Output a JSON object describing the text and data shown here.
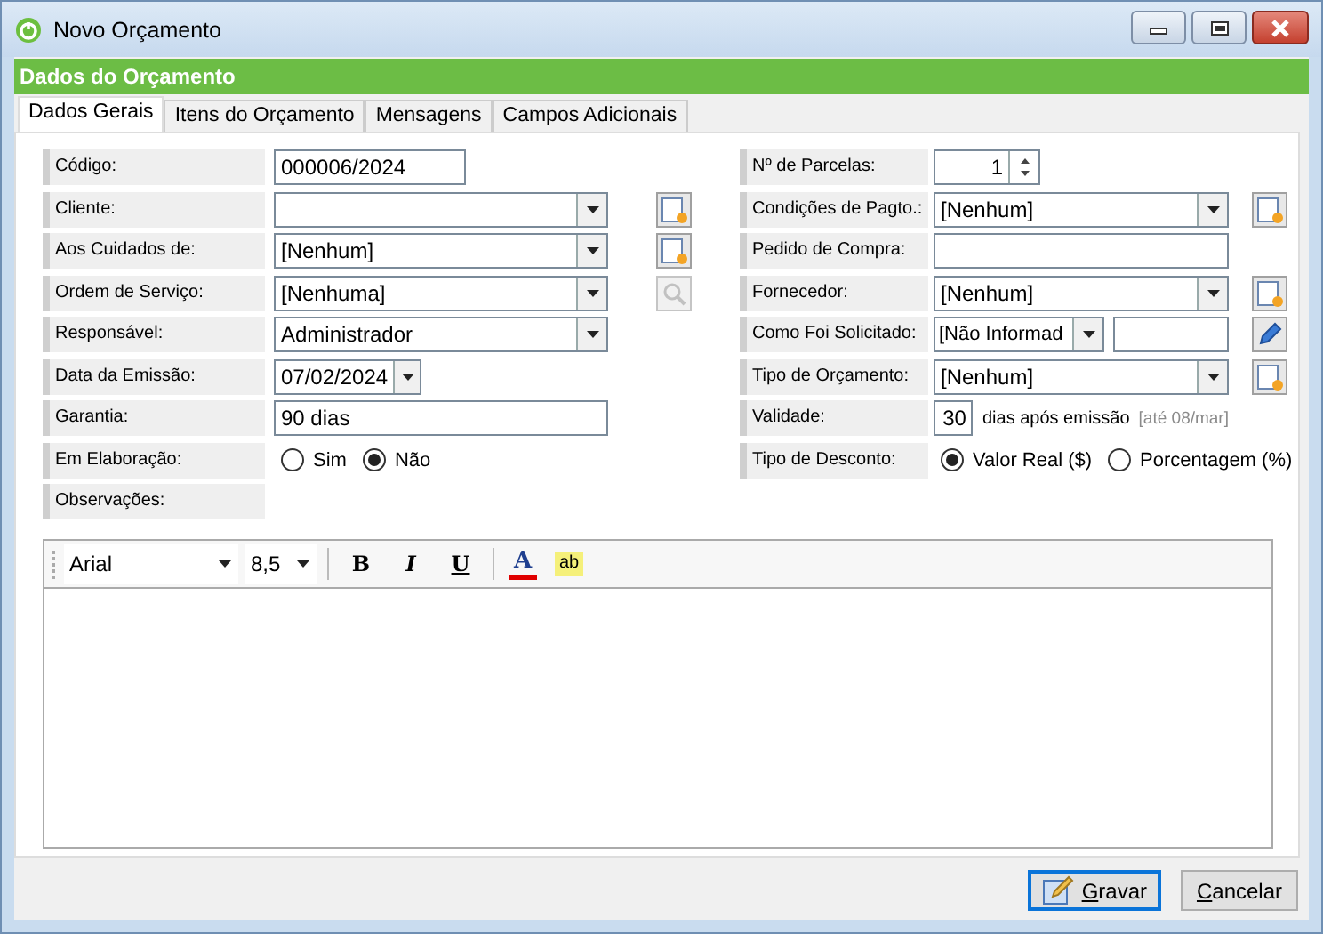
{
  "window": {
    "title": "Novo Orçamento"
  },
  "header": "Dados do Orçamento",
  "tabs": [
    {
      "label": "Dados Gerais",
      "selected": true
    },
    {
      "label": "Itens do Orçamento",
      "selected": false
    },
    {
      "label": "Mensagens",
      "selected": false
    },
    {
      "label": "Campos Adicionais",
      "selected": false
    }
  ],
  "left_fields": [
    {
      "label": "Código:",
      "kind": "short_text",
      "value": "000006/2024"
    },
    {
      "label": "Cliente:",
      "kind": "combo",
      "action": {
        "kind": "add",
        "disabled": false
      }
    },
    {
      "label": "Aos Cuidados de:",
      "kind": "combo",
      "value": "[Nenhum]",
      "action": {
        "kind": "add",
        "disabled": false
      }
    },
    {
      "label": "Ordem de Serviço:",
      "kind": "combo",
      "value": "[Nenhuma]",
      "action": {
        "kind": "search",
        "disabled": true
      }
    },
    {
      "label": "Responsável:",
      "kind": "combo",
      "value": "Administrador"
    },
    {
      "label": "Data da Emissão:",
      "kind": "date",
      "value": "07/02/2024"
    },
    {
      "label": "Garantia:",
      "kind": "text",
      "value": "90 dias"
    },
    {
      "label": "Em Elaboração:",
      "kind": "radio",
      "options": [
        {
          "label": "Sim",
          "selected": false
        },
        {
          "label": "Não",
          "selected": true
        }
      ]
    },
    {
      "label": "Observações:",
      "kind": "none"
    }
  ],
  "right_fields": [
    {
      "label": "Nº de Parcelas:",
      "kind": "spinner",
      "value": "1"
    },
    {
      "label": "Condições de Pagto.:",
      "kind": "combo",
      "value": "[Nenhum]",
      "action": {
        "kind": "add",
        "disabled": false
      }
    },
    {
      "label": "Pedido de Compra:",
      "kind": "text"
    },
    {
      "label": "Fornecedor:",
      "kind": "combo",
      "value": "[Nenhum]",
      "action": {
        "kind": "add",
        "disabled": false
      }
    },
    {
      "label": "Como Foi Solicitado:",
      "kind": "combo_text",
      "value": "[Não Informad",
      "action": {
        "kind": "edit",
        "disabled": false
      }
    },
    {
      "label": "Tipo de Orçamento:",
      "kind": "combo",
      "value": "[Nenhum]",
      "action": {
        "kind": "add",
        "disabled": false
      }
    },
    {
      "label": "Validade:",
      "kind": "validity",
      "value": "30",
      "suffix": "dias após emissão",
      "note": "[até 08/mar]"
    },
    {
      "label": "Tipo de Desconto:",
      "kind": "radio",
      "options": [
        {
          "label": "Valor Real ($)",
          "selected": true
        },
        {
          "label": "Porcentagem (%)",
          "selected": false
        }
      ]
    }
  ],
  "editor": {
    "font": "Arial",
    "size": "8,5",
    "format_buttons": [
      {
        "kind": "bold",
        "label": "B"
      },
      {
        "kind": "italic",
        "label": "I"
      },
      {
        "kind": "underline",
        "label": "U"
      }
    ],
    "font_color_label": "A",
    "highlight_label": "ab"
  },
  "buttons": [
    {
      "label": "Gravar",
      "kind": "save",
      "default": true
    },
    {
      "label": "Cancelar",
      "kind": "cancel",
      "default": false
    }
  ]
}
